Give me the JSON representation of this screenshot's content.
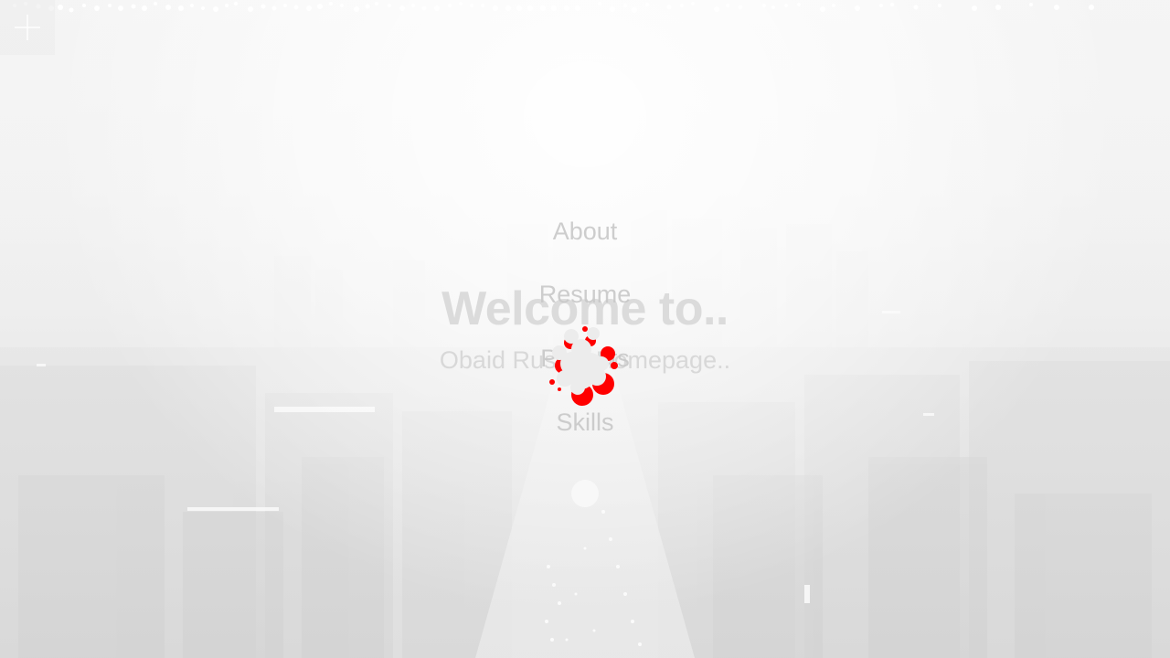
{
  "hero": {
    "title": "Welcome to..",
    "subtitle": "Obaid Rushdi Homepage.."
  },
  "nav": {
    "items": [
      {
        "label": "About"
      },
      {
        "label": "Resume"
      },
      {
        "label": "Projects"
      },
      {
        "label": "Skills"
      }
    ]
  },
  "icons": {
    "menu": "plus-icon",
    "loader": "loading-spinner-icon",
    "snow": "snowflake-icon",
    "nav_dot": "circle-icon"
  },
  "colors": {
    "background": "#f1f1f1",
    "text_faded": "#d0d0d0",
    "loader_accent": "#ff0000",
    "snow": "#ffffff"
  }
}
